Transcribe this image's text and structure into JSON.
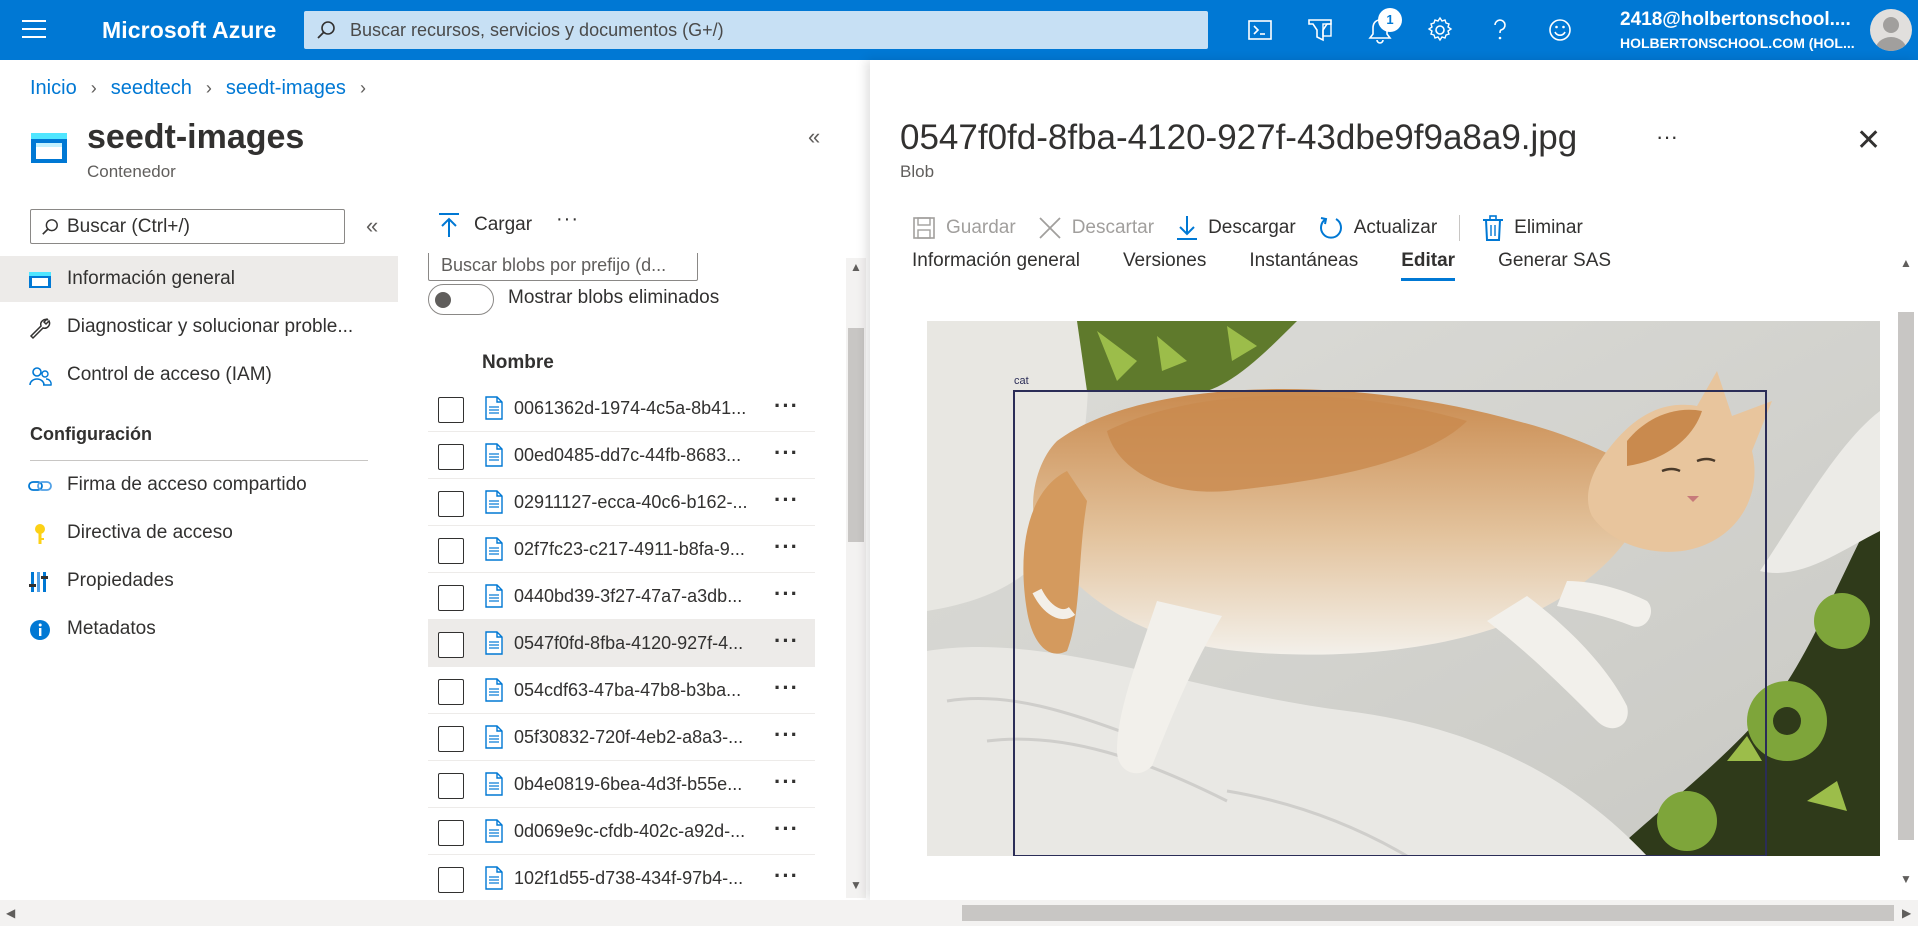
{
  "topbar": {
    "brand": "Microsoft Azure",
    "search_placeholder": "Buscar recursos, servicios y documentos (G+/)",
    "notification_count": "1",
    "account_name": "2418@holbertonschool....",
    "account_org": "HOLBERTONSCHOOL.COM (HOL..."
  },
  "breadcrumb": [
    "Inicio",
    "seedtech",
    "seedt-images"
  ],
  "resource": {
    "title": "seedt-images",
    "subtitle": "Contenedor"
  },
  "nav": {
    "search_placeholder": "Buscar (Ctrl+/)",
    "items": [
      {
        "label": "Información general",
        "icon": "container-icon",
        "selected": true
      },
      {
        "label": "Diagnosticar y solucionar proble...",
        "icon": "wrench-icon"
      },
      {
        "label": "Control de acceso (IAM)",
        "icon": "people-icon"
      }
    ],
    "section": "Configuración",
    "config_items": [
      {
        "label": "Firma de acceso compartido",
        "icon": "link-icon"
      },
      {
        "label": "Directiva de acceso",
        "icon": "key-icon"
      },
      {
        "label": "Propiedades",
        "icon": "properties-icon"
      },
      {
        "label": "Metadatos",
        "icon": "info-icon"
      }
    ]
  },
  "blob_list": {
    "upload_label": "Cargar",
    "prefix_placeholder": "Buscar blobs por prefijo (d...",
    "show_deleted_label": "Mostrar blobs eliminados",
    "column_name": "Nombre",
    "rows": [
      "0061362d-1974-4c5a-8b41...",
      "00ed0485-dd7c-44fb-8683...",
      "02911127-ecca-40c6-b162-...",
      "02f7fc23-c217-4911-b8fa-9...",
      "0440bd39-3f27-47a7-a3db...",
      "0547f0fd-8fba-4120-927f-4...",
      "054cdf63-47ba-47b8-b3ba...",
      "05f30832-720f-4eb2-a8a3-...",
      "0b4e0819-6bea-4d3f-b55e...",
      "0d069e9c-cfdb-402c-a92d-...",
      "102f1d55-d738-434f-97b4-..."
    ],
    "selected_index": 5
  },
  "blade": {
    "title": "0547f0fd-8fba-4120-927f-43dbe9f9a8a9.jpg",
    "subtitle": "Blob",
    "toolbar": {
      "save": "Guardar",
      "discard": "Descartar",
      "download": "Descargar",
      "refresh": "Actualizar",
      "delete": "Eliminar"
    },
    "tabs": [
      "Información general",
      "Versiones",
      "Instantáneas",
      "Editar",
      "Generar SAS"
    ],
    "active_tab": "Editar",
    "image_label": "cat",
    "colors": {
      "accent": "#0078d4",
      "bbox": "#2b2d57"
    }
  }
}
